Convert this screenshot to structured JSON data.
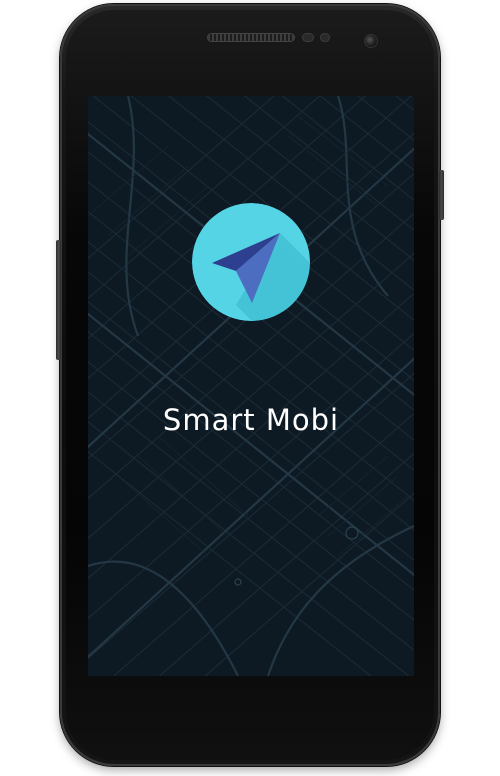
{
  "app": {
    "name": "Smart Mobi"
  },
  "colors": {
    "screen_background": "#0d1a23",
    "map_roads": "#1e2e39",
    "logo_circle": "#55d4e6",
    "logo_arrow_dark": "#2e3f8f",
    "logo_arrow_light": "#4d6ec0",
    "title_text": "#ffffff"
  },
  "icons": {
    "logo": "navigation-arrow-icon"
  }
}
